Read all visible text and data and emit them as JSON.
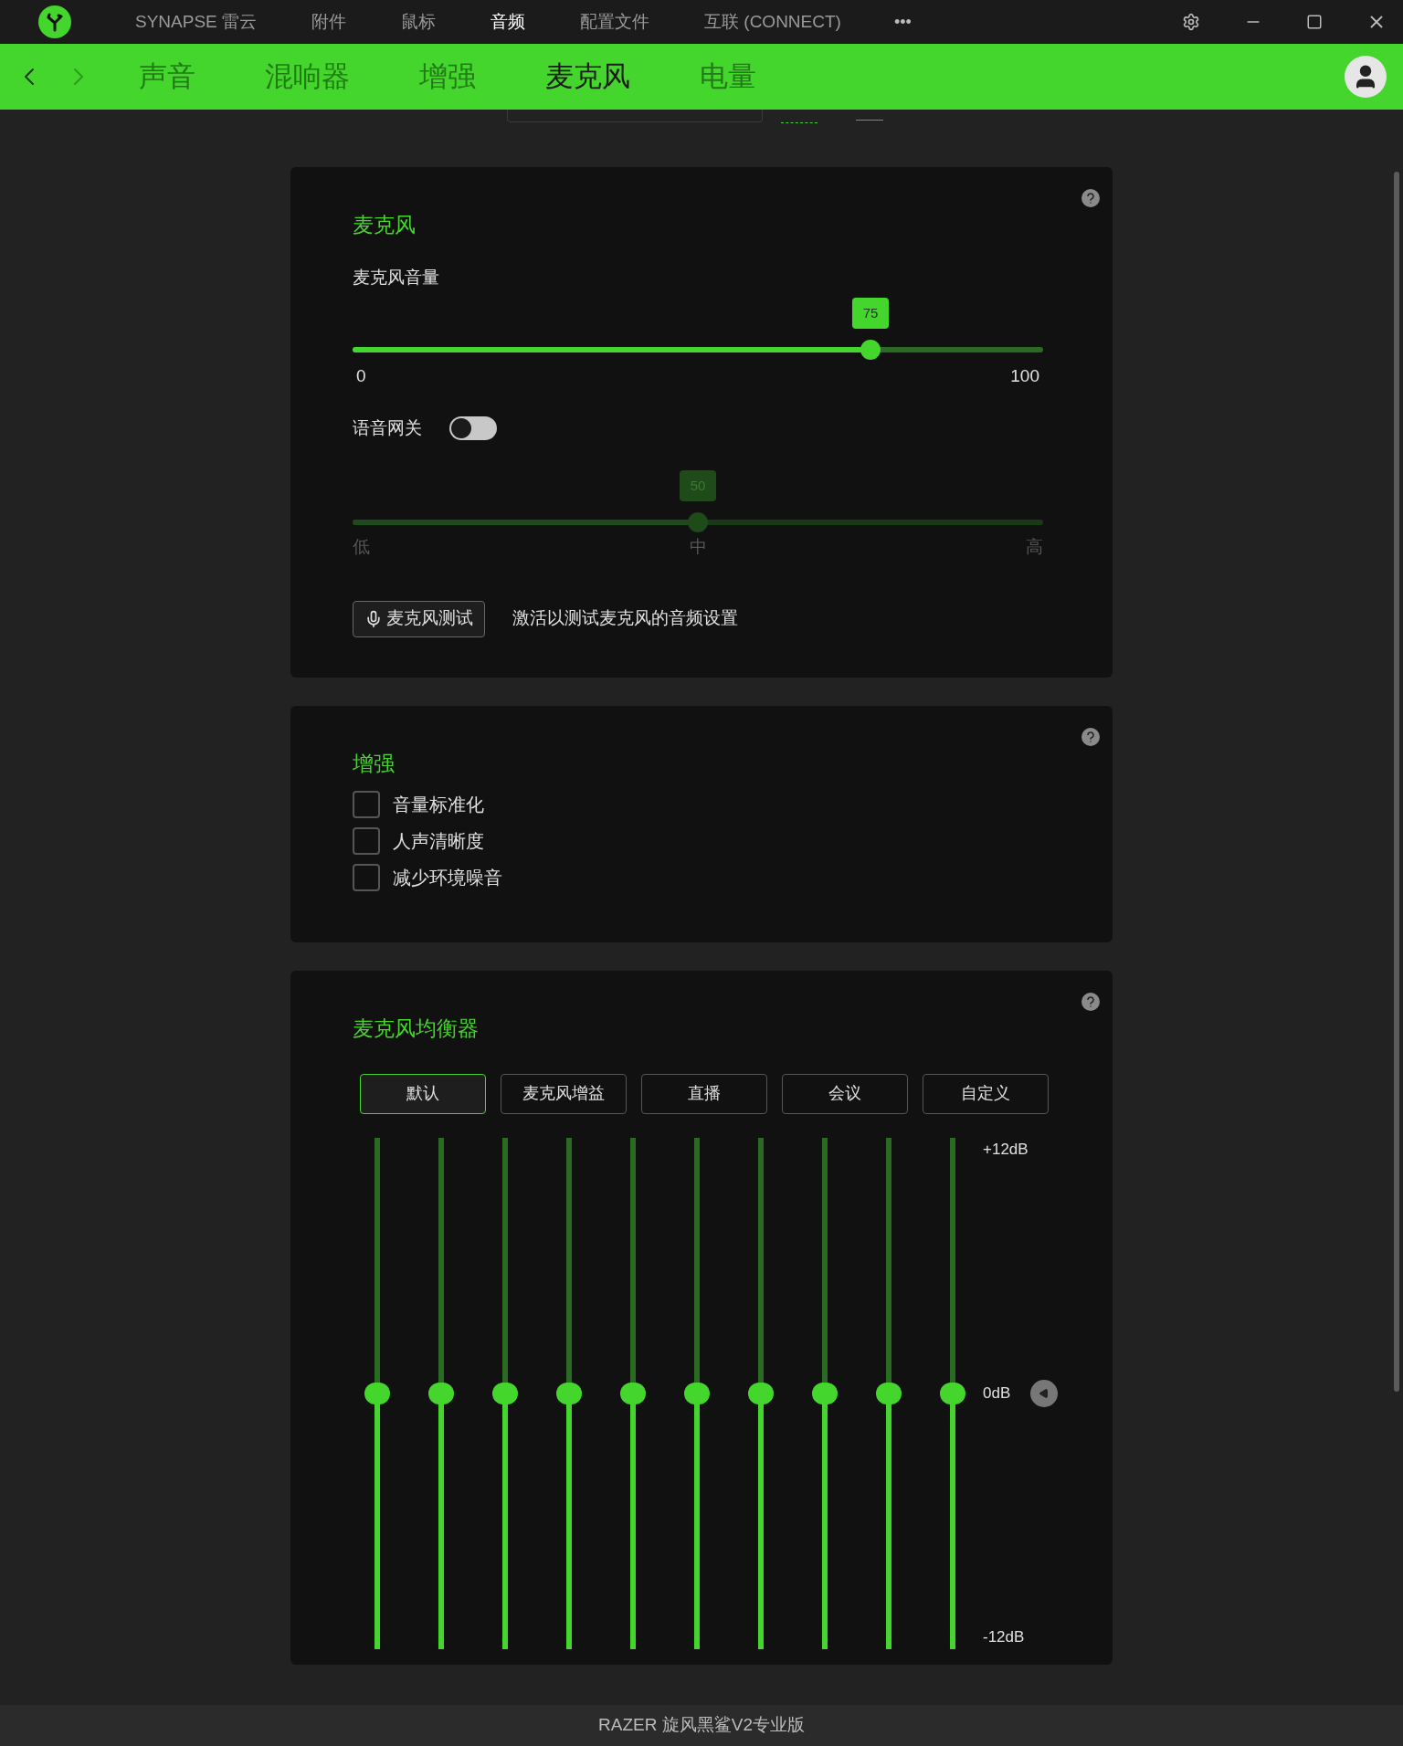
{
  "title_bar": {
    "nav": [
      {
        "label": "SYNAPSE 雷云",
        "selected": false
      },
      {
        "label": "附件",
        "selected": false
      },
      {
        "label": "鼠标",
        "selected": false
      },
      {
        "label": "音频",
        "selected": true
      },
      {
        "label": "配置文件",
        "selected": false
      },
      {
        "label": "互联 (CONNECT)",
        "selected": false
      }
    ],
    "more": "•••"
  },
  "sub_nav": {
    "forward_disabled": true,
    "tabs": [
      {
        "label": "声音",
        "selected": false
      },
      {
        "label": "混响器",
        "selected": false
      },
      {
        "label": "增强",
        "selected": false
      },
      {
        "label": "麦克风",
        "selected": true
      },
      {
        "label": "电量",
        "selected": false
      }
    ]
  },
  "microphone": {
    "title": "麦克风",
    "volume_label": "麦克风音量",
    "volume": {
      "level": 0.75,
      "value": "75",
      "min": "0",
      "max": "100"
    },
    "gate_label": "语音网关",
    "gate_on": false,
    "gate": {
      "level": 0.5,
      "value": "50",
      "low": "低",
      "mid": "中",
      "high": "高"
    },
    "test_button": "麦克风测试",
    "test_hint": "激活以测试麦克风的音频设置"
  },
  "enhance": {
    "title": "增强",
    "options": [
      {
        "label": "音量标准化",
        "checked": false
      },
      {
        "label": "人声清晰度",
        "checked": false
      },
      {
        "label": "减少环境噪音",
        "checked": false
      }
    ]
  },
  "equalizer": {
    "title": "麦克风均衡器",
    "presets": [
      {
        "label": "默认",
        "selected": true
      },
      {
        "label": "麦克风增益",
        "selected": false
      },
      {
        "label": "直播",
        "selected": false
      },
      {
        "label": "会议",
        "selected": false
      },
      {
        "label": "自定义",
        "selected": false
      }
    ],
    "bands": [
      {
        "level": 0.5
      },
      {
        "level": 0.5
      },
      {
        "level": 0.5
      },
      {
        "level": 0.5
      },
      {
        "level": 0.5
      },
      {
        "level": 0.5
      },
      {
        "level": 0.5
      },
      {
        "level": 0.5
      },
      {
        "level": 0.5
      },
      {
        "level": 0.5
      }
    ],
    "top_label": "+12dB",
    "mid_label": "0dB",
    "bottom_label": "-12dB"
  },
  "status_bar": {
    "device": "RAZER 旋风黑鲨V2专业版"
  }
}
